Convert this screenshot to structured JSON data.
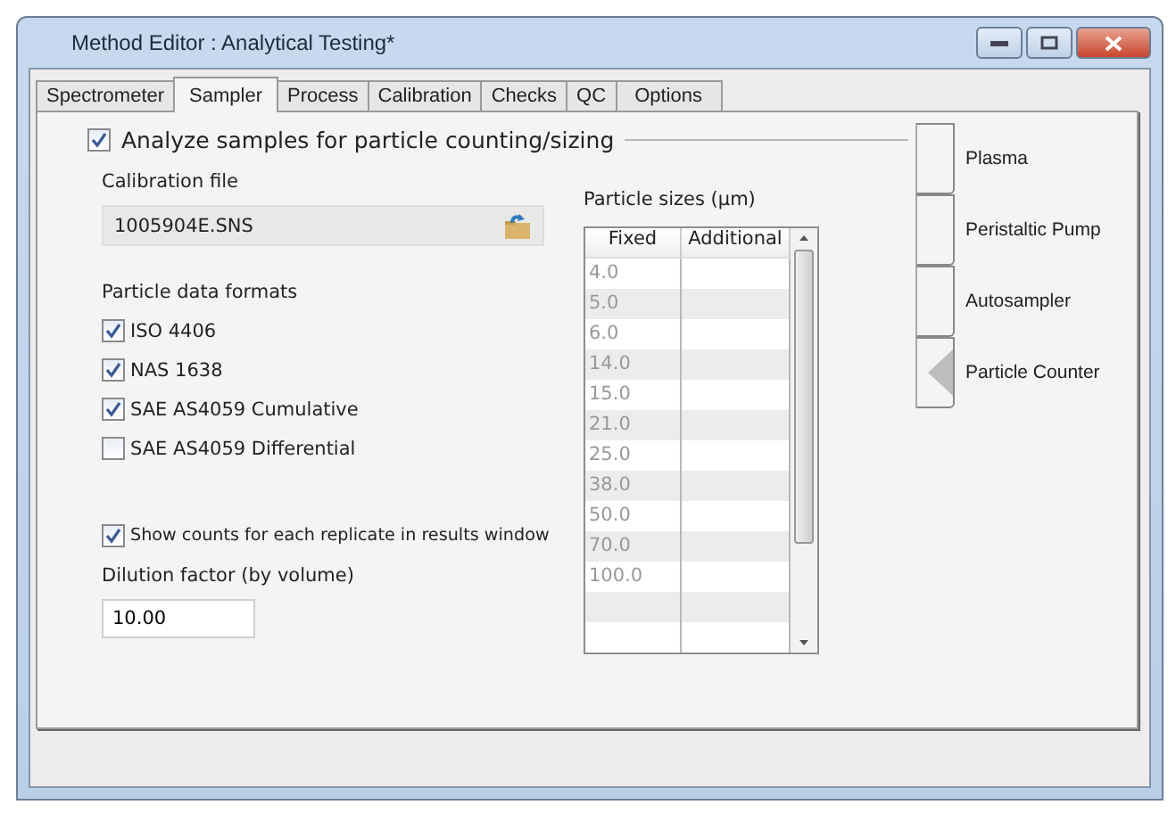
{
  "window": {
    "title": "Method Editor : Analytical Testing*"
  },
  "tabs": [
    {
      "label": "Spectrometer",
      "selected": false
    },
    {
      "label": "Sampler",
      "selected": true
    },
    {
      "label": "Process",
      "selected": false
    },
    {
      "label": "Calibration",
      "selected": false
    },
    {
      "label": "Checks",
      "selected": false
    },
    {
      "label": "QC",
      "selected": false
    },
    {
      "label": "Options",
      "selected": false
    }
  ],
  "group": {
    "label": "Analyze samples for particle counting/sizing",
    "checked": true
  },
  "calibration_file": {
    "label": "Calibration file",
    "value": "1005904E.SNS"
  },
  "formats": {
    "label": "Particle data formats",
    "items": [
      {
        "label": "ISO 4406",
        "checked": true
      },
      {
        "label": "NAS 1638",
        "checked": true
      },
      {
        "label": "SAE AS4059 Cumulative",
        "checked": true
      },
      {
        "label": "SAE AS4059 Differential",
        "checked": false
      }
    ]
  },
  "show_counts": {
    "label": "Show counts for each replicate in results window",
    "checked": true
  },
  "dilution": {
    "label": "Dilution factor (by volume)",
    "value": "10.00"
  },
  "particle_sizes": {
    "label": "Particle sizes (µm)",
    "columns": [
      "Fixed",
      "Additional"
    ],
    "rows": [
      [
        "4.0",
        ""
      ],
      [
        "5.0",
        ""
      ],
      [
        "6.0",
        ""
      ],
      [
        "14.0",
        ""
      ],
      [
        "15.0",
        ""
      ],
      [
        "21.0",
        ""
      ],
      [
        "25.0",
        ""
      ],
      [
        "38.0",
        ""
      ],
      [
        "50.0",
        ""
      ],
      [
        "70.0",
        ""
      ],
      [
        "100.0",
        ""
      ],
      [
        "",
        ""
      ],
      [
        "",
        ""
      ]
    ]
  },
  "side_tabs": [
    {
      "label": "Plasma",
      "selected": false
    },
    {
      "label": "Peristaltic Pump",
      "selected": false
    },
    {
      "label": "Autosampler",
      "selected": false
    },
    {
      "label": "Particle Counter",
      "selected": true
    }
  ]
}
